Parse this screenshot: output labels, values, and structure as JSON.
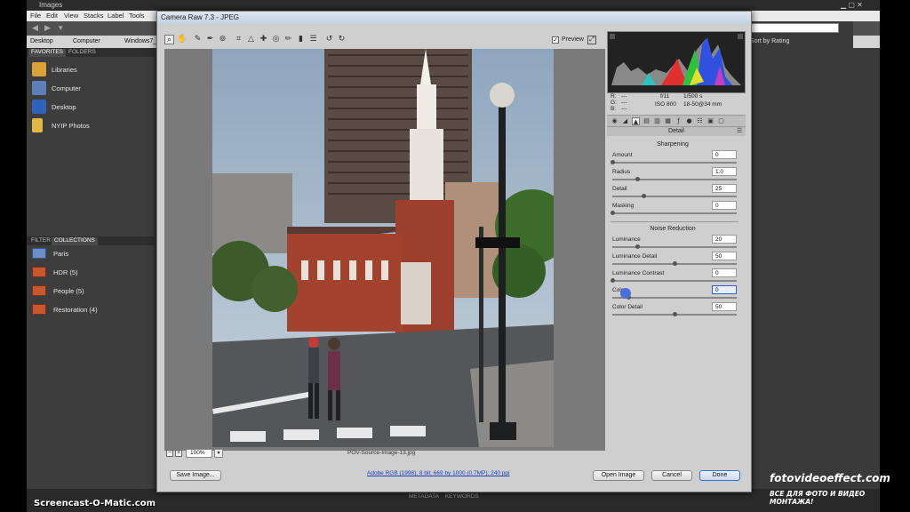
{
  "bridge": {
    "title": "Images",
    "menu": [
      "File",
      "Edit",
      "View",
      "Stacks",
      "Label",
      "Tools"
    ],
    "path": [
      "Desktop",
      "Computer",
      "Windows7_"
    ],
    "favorites_tab": "FAVORITES",
    "folders_tab": "FOLDERS",
    "favorites": [
      {
        "label": "Libraries",
        "icon": "libraries-icon"
      },
      {
        "label": "Computer",
        "icon": "computer-icon"
      },
      {
        "label": "Desktop",
        "icon": "desktop-icon"
      },
      {
        "label": "NYIP Photos",
        "icon": "folder-icon"
      }
    ],
    "filter_tab": "FILTER",
    "collections_tab": "COLLECTIONS",
    "collections": [
      {
        "label": "Paris"
      },
      {
        "label": "HDR (5)"
      },
      {
        "label": "People (5)"
      },
      {
        "label": "Restoration (4)"
      }
    ],
    "search_placeholder": "ρ•",
    "sort_label": "Sort by Rating",
    "metadata_tab": "METADATA",
    "keywords_tab": "KEYWORDS"
  },
  "acr": {
    "title": "Camera Raw 7.3 - JPEG",
    "preview_label": "Preview",
    "preview_checked": "✓",
    "zoom": "100%",
    "filename": "POV-Source-Image-13.jpg",
    "readout": {
      "r_label": "R:",
      "r_val": "---",
      "g_label": "G:",
      "g_val": "---",
      "b_label": "B:",
      "b_val": "---",
      "aperture": "f/11",
      "shutter": "1/500 s",
      "iso": "ISO 800",
      "lens": "18-50@34 mm"
    },
    "panel_title": "Detail",
    "sharpening_title": "Sharpening",
    "noise_title": "Noise Reduction",
    "sharpening": [
      {
        "label": "Amount",
        "value": "0",
        "pos": 0
      },
      {
        "label": "Radius",
        "value": "1.0",
        "pos": 0.2
      },
      {
        "label": "Detail",
        "value": "25",
        "pos": 0.25
      },
      {
        "label": "Masking",
        "value": "0",
        "pos": 0
      }
    ],
    "noise": [
      {
        "label": "Luminance",
        "value": "20",
        "pos": 0.2
      },
      {
        "label": "Luminance Detail",
        "value": "50",
        "pos": 0.5
      },
      {
        "label": "Luminance Contrast",
        "value": "0",
        "pos": 0
      },
      {
        "label": "Color",
        "value": "0",
        "pos": 0.13
      },
      {
        "label": "Color Detail",
        "value": "50",
        "pos": 0.5
      }
    ],
    "save_button": "Save Image...",
    "workflow_link": "Adobe RGB (1998); 8 bit; 669 by 1000 (0.7MP); 240 ppi",
    "open_button": "Open Image",
    "cancel_button": "Cancel",
    "done_button": "Done"
  },
  "watermarks": {
    "left": "Screencast-O-Matic.com",
    "right": "fotovideoeffect.com",
    "right_sub": "ВСЕ ДЛЯ ФОТО И ВИДЕО МОНТАЖА!"
  }
}
